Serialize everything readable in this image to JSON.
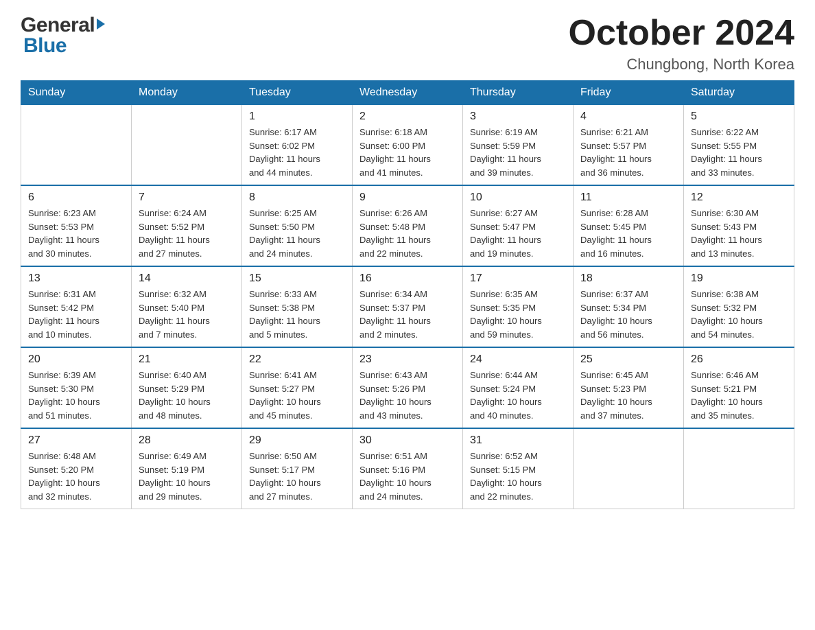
{
  "header": {
    "logo_general": "General",
    "logo_blue": "Blue",
    "month_year": "October 2024",
    "location": "Chungbong, North Korea"
  },
  "days_of_week": [
    "Sunday",
    "Monday",
    "Tuesday",
    "Wednesday",
    "Thursday",
    "Friday",
    "Saturday"
  ],
  "weeks": [
    [
      {
        "day": "",
        "info": ""
      },
      {
        "day": "",
        "info": ""
      },
      {
        "day": "1",
        "info": "Sunrise: 6:17 AM\nSunset: 6:02 PM\nDaylight: 11 hours\nand 44 minutes."
      },
      {
        "day": "2",
        "info": "Sunrise: 6:18 AM\nSunset: 6:00 PM\nDaylight: 11 hours\nand 41 minutes."
      },
      {
        "day": "3",
        "info": "Sunrise: 6:19 AM\nSunset: 5:59 PM\nDaylight: 11 hours\nand 39 minutes."
      },
      {
        "day": "4",
        "info": "Sunrise: 6:21 AM\nSunset: 5:57 PM\nDaylight: 11 hours\nand 36 minutes."
      },
      {
        "day": "5",
        "info": "Sunrise: 6:22 AM\nSunset: 5:55 PM\nDaylight: 11 hours\nand 33 minutes."
      }
    ],
    [
      {
        "day": "6",
        "info": "Sunrise: 6:23 AM\nSunset: 5:53 PM\nDaylight: 11 hours\nand 30 minutes."
      },
      {
        "day": "7",
        "info": "Sunrise: 6:24 AM\nSunset: 5:52 PM\nDaylight: 11 hours\nand 27 minutes."
      },
      {
        "day": "8",
        "info": "Sunrise: 6:25 AM\nSunset: 5:50 PM\nDaylight: 11 hours\nand 24 minutes."
      },
      {
        "day": "9",
        "info": "Sunrise: 6:26 AM\nSunset: 5:48 PM\nDaylight: 11 hours\nand 22 minutes."
      },
      {
        "day": "10",
        "info": "Sunrise: 6:27 AM\nSunset: 5:47 PM\nDaylight: 11 hours\nand 19 minutes."
      },
      {
        "day": "11",
        "info": "Sunrise: 6:28 AM\nSunset: 5:45 PM\nDaylight: 11 hours\nand 16 minutes."
      },
      {
        "day": "12",
        "info": "Sunrise: 6:30 AM\nSunset: 5:43 PM\nDaylight: 11 hours\nand 13 minutes."
      }
    ],
    [
      {
        "day": "13",
        "info": "Sunrise: 6:31 AM\nSunset: 5:42 PM\nDaylight: 11 hours\nand 10 minutes."
      },
      {
        "day": "14",
        "info": "Sunrise: 6:32 AM\nSunset: 5:40 PM\nDaylight: 11 hours\nand 7 minutes."
      },
      {
        "day": "15",
        "info": "Sunrise: 6:33 AM\nSunset: 5:38 PM\nDaylight: 11 hours\nand 5 minutes."
      },
      {
        "day": "16",
        "info": "Sunrise: 6:34 AM\nSunset: 5:37 PM\nDaylight: 11 hours\nand 2 minutes."
      },
      {
        "day": "17",
        "info": "Sunrise: 6:35 AM\nSunset: 5:35 PM\nDaylight: 10 hours\nand 59 minutes."
      },
      {
        "day": "18",
        "info": "Sunrise: 6:37 AM\nSunset: 5:34 PM\nDaylight: 10 hours\nand 56 minutes."
      },
      {
        "day": "19",
        "info": "Sunrise: 6:38 AM\nSunset: 5:32 PM\nDaylight: 10 hours\nand 54 minutes."
      }
    ],
    [
      {
        "day": "20",
        "info": "Sunrise: 6:39 AM\nSunset: 5:30 PM\nDaylight: 10 hours\nand 51 minutes."
      },
      {
        "day": "21",
        "info": "Sunrise: 6:40 AM\nSunset: 5:29 PM\nDaylight: 10 hours\nand 48 minutes."
      },
      {
        "day": "22",
        "info": "Sunrise: 6:41 AM\nSunset: 5:27 PM\nDaylight: 10 hours\nand 45 minutes."
      },
      {
        "day": "23",
        "info": "Sunrise: 6:43 AM\nSunset: 5:26 PM\nDaylight: 10 hours\nand 43 minutes."
      },
      {
        "day": "24",
        "info": "Sunrise: 6:44 AM\nSunset: 5:24 PM\nDaylight: 10 hours\nand 40 minutes."
      },
      {
        "day": "25",
        "info": "Sunrise: 6:45 AM\nSunset: 5:23 PM\nDaylight: 10 hours\nand 37 minutes."
      },
      {
        "day": "26",
        "info": "Sunrise: 6:46 AM\nSunset: 5:21 PM\nDaylight: 10 hours\nand 35 minutes."
      }
    ],
    [
      {
        "day": "27",
        "info": "Sunrise: 6:48 AM\nSunset: 5:20 PM\nDaylight: 10 hours\nand 32 minutes."
      },
      {
        "day": "28",
        "info": "Sunrise: 6:49 AM\nSunset: 5:19 PM\nDaylight: 10 hours\nand 29 minutes."
      },
      {
        "day": "29",
        "info": "Sunrise: 6:50 AM\nSunset: 5:17 PM\nDaylight: 10 hours\nand 27 minutes."
      },
      {
        "day": "30",
        "info": "Sunrise: 6:51 AM\nSunset: 5:16 PM\nDaylight: 10 hours\nand 24 minutes."
      },
      {
        "day": "31",
        "info": "Sunrise: 6:52 AM\nSunset: 5:15 PM\nDaylight: 10 hours\nand 22 minutes."
      },
      {
        "day": "",
        "info": ""
      },
      {
        "day": "",
        "info": ""
      }
    ]
  ]
}
